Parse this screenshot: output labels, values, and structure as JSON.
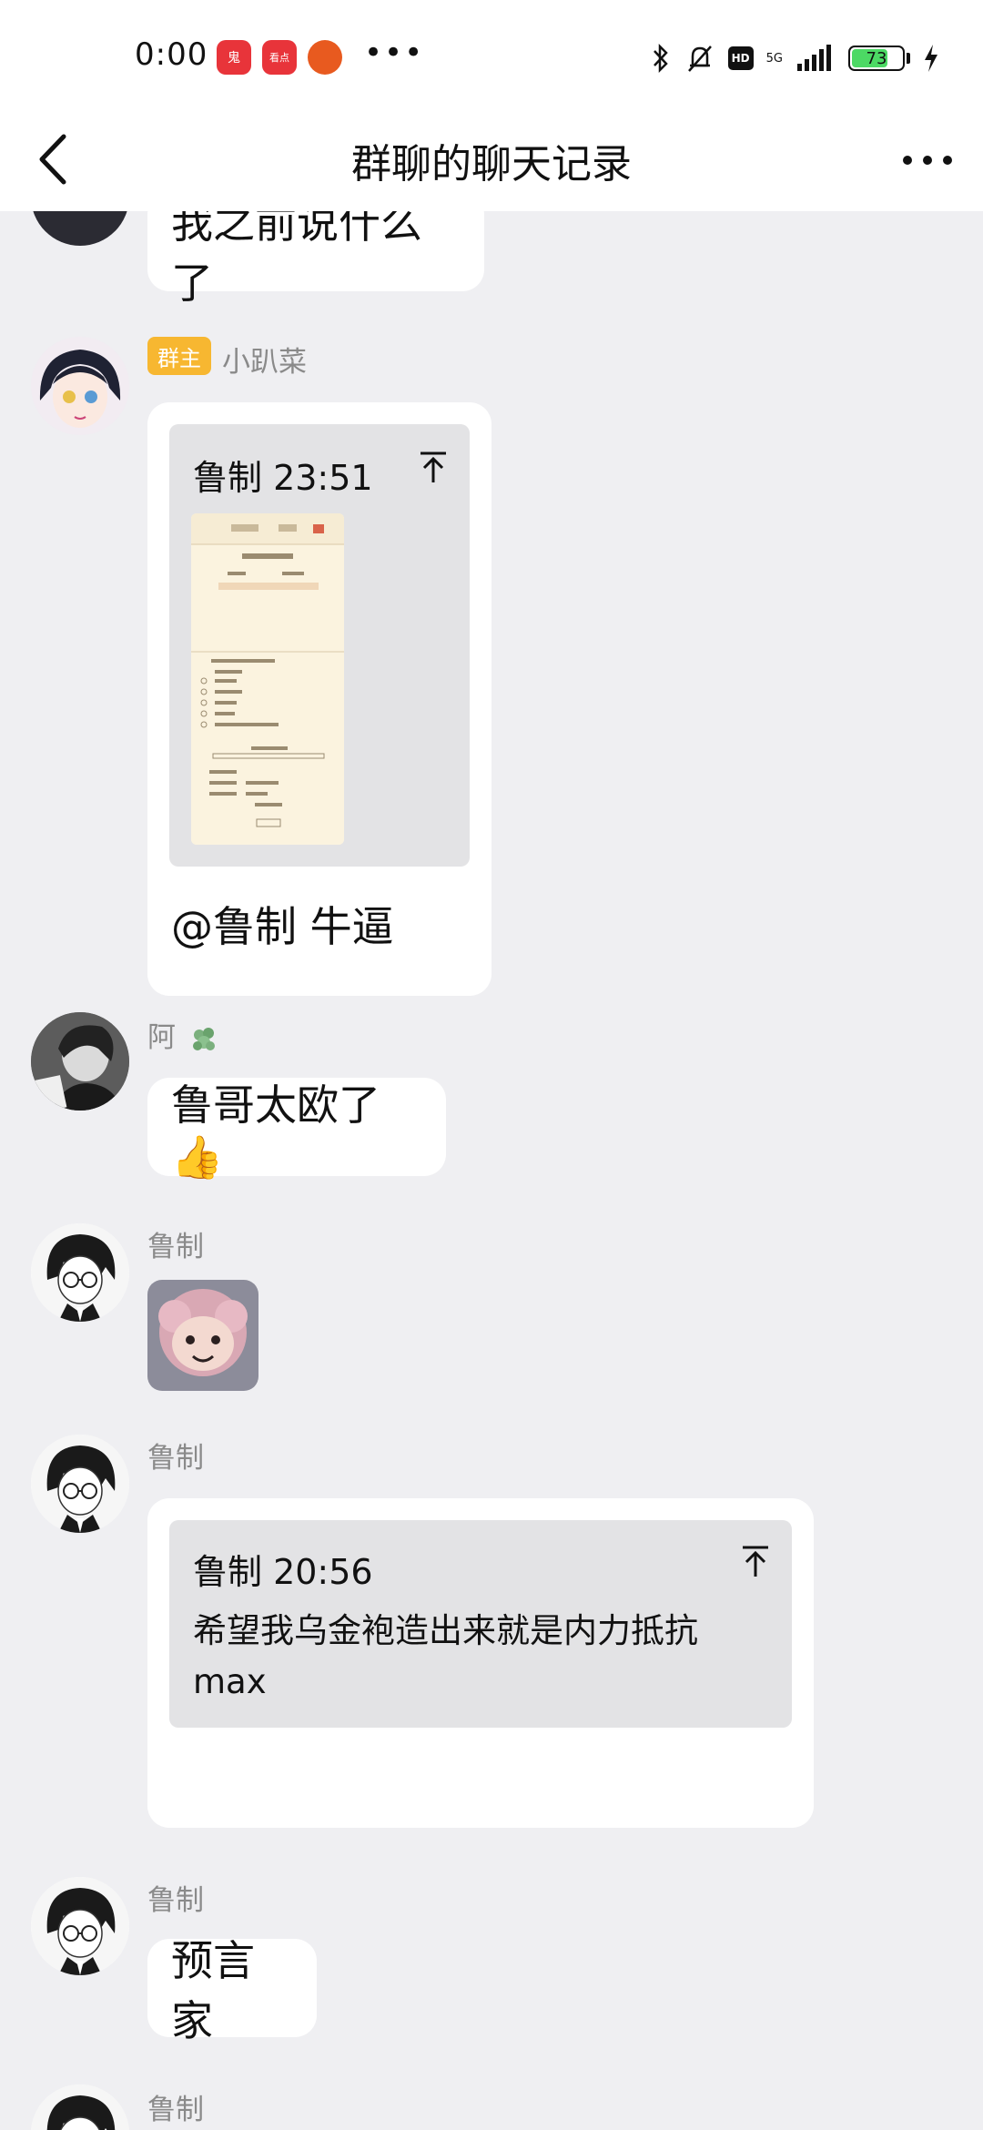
{
  "status_bar": {
    "time": "0:00",
    "app_badge_1": "鬼",
    "app_badge_2": "看点",
    "more": "•••",
    "network": "5G",
    "battery_level": "73"
  },
  "nav": {
    "title": "群聊的聊天记录"
  },
  "messages": {
    "m1": {
      "text": "我之前说什么了"
    },
    "m2": {
      "sender": "小趴菜",
      "role_badge": "群主",
      "quote_author_time": "鲁制 23:51",
      "text": "@鲁制 牛逼"
    },
    "m3": {
      "sender": "阿",
      "text": "鲁哥太欧了👍"
    },
    "m4": {
      "sender": "鲁制"
    },
    "m5": {
      "sender": "鲁制",
      "quote_author_time": "鲁制 20:56",
      "quote_text_line1": "希望我乌金袍造出来就是内力抵抗",
      "quote_text_line2": "max"
    },
    "m6": {
      "sender": "鲁制",
      "text": "预言家"
    },
    "m7": {
      "sender": "鲁制"
    }
  },
  "colors": {
    "background": "#EFEFF2",
    "bubble": "#FFFFFF",
    "owner_badge": "#F7B731",
    "sender_name": "#8A8A8A",
    "quote_bg": "#E3E3E5"
  }
}
